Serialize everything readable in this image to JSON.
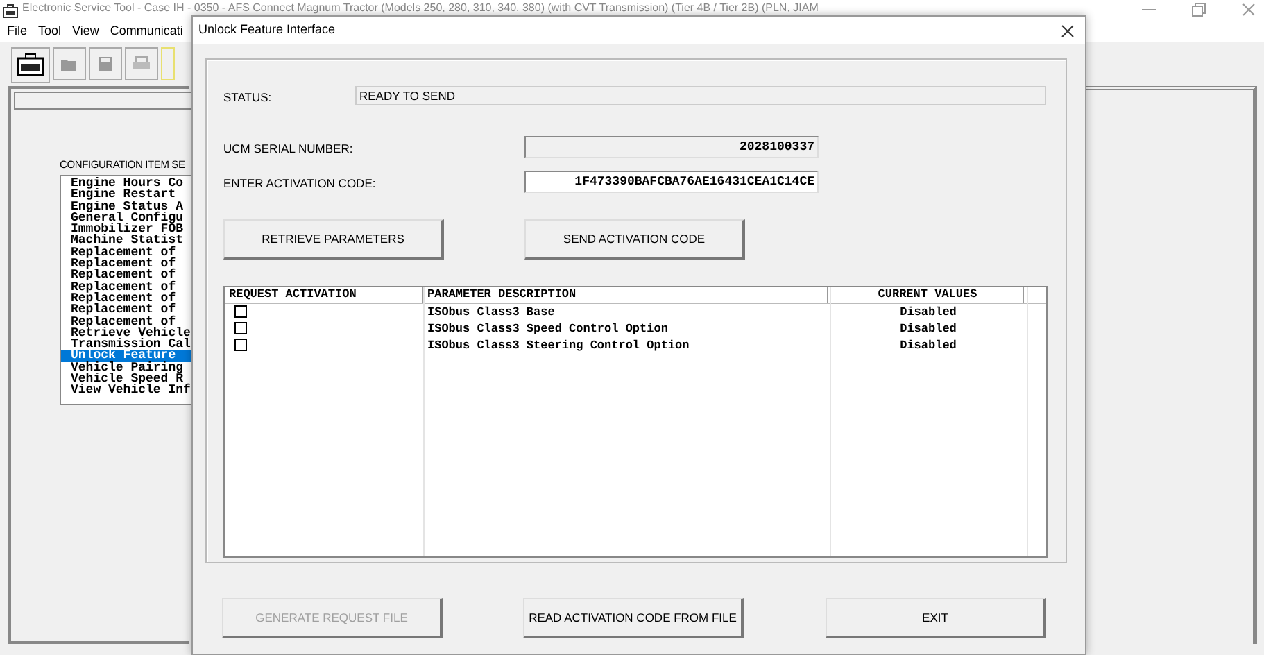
{
  "main_window": {
    "title": "Electronic Service Tool - Case IH - 0350 - AFS Connect Magnum Tractor (Models 250, 280, 310, 340, 380) (with CVT Transmission) (Tier 4B / Tier 2B) (PLN, JIAM",
    "menu": [
      "File",
      "Tool",
      "View",
      "Communicati"
    ],
    "list_label": "CONFIGURATION ITEM SE",
    "list_items": [
      {
        "label": "Engine Hours Co",
        "selected": false
      },
      {
        "label": "Engine Restart",
        "selected": false
      },
      {
        "label": "Engine Status A",
        "selected": false
      },
      {
        "label": "General Configu",
        "selected": false
      },
      {
        "label": "Immobilizer FOB",
        "selected": false
      },
      {
        "label": "Machine Statist",
        "selected": false
      },
      {
        "label": "Replacement of",
        "selected": false
      },
      {
        "label": "Replacement of",
        "selected": false
      },
      {
        "label": "Replacement of",
        "selected": false
      },
      {
        "label": "Replacement of",
        "selected": false
      },
      {
        "label": "Replacement of",
        "selected": false
      },
      {
        "label": "Replacement of",
        "selected": false
      },
      {
        "label": "Replacement of",
        "selected": false
      },
      {
        "label": "Retrieve Vehicle",
        "selected": false
      },
      {
        "label": "Transmission Cal",
        "selected": false
      },
      {
        "label": "Unlock Feature",
        "selected": true
      },
      {
        "label": "Vehicle Pairing",
        "selected": false
      },
      {
        "label": "Vehicle Speed R",
        "selected": false
      },
      {
        "label": "View Vehicle Inf",
        "selected": false
      }
    ]
  },
  "dialog": {
    "title": "Unlock Feature Interface",
    "status_label": "STATUS:",
    "status": "READY TO SEND",
    "fields": [
      {
        "label": "UCM SERIAL NUMBER:",
        "value": "2028100337",
        "editable": false
      },
      {
        "label": "ENTER ACTIVATION CODE:",
        "value": "1F473390BAFCBA76AE16431CEA1C14CE",
        "editable": true
      }
    ],
    "action_buttons": [
      {
        "label": "RETRIEVE PARAMETERS",
        "disabled": false
      },
      {
        "label": "SEND ACTIVATION CODE",
        "disabled": false
      }
    ],
    "table": {
      "columns": [
        "REQUEST ACTIVATION",
        "PARAMETER DESCRIPTION",
        "CURRENT VALUES"
      ],
      "rows": [
        {
          "checked": false,
          "description": "ISObus Class3 Base",
          "current_value": "Disabled"
        },
        {
          "checked": false,
          "description": "ISObus Class3 Speed Control Option",
          "current_value": "Disabled"
        },
        {
          "checked": false,
          "description": "ISObus Class3 Steering Control Option",
          "current_value": "Disabled"
        }
      ]
    },
    "footer_buttons": [
      {
        "label": "GENERATE REQUEST FILE",
        "disabled": true
      },
      {
        "label": "READ ACTIVATION CODE FROM FILE",
        "disabled": false
      },
      {
        "label": "EXIT",
        "disabled": false
      }
    ]
  }
}
